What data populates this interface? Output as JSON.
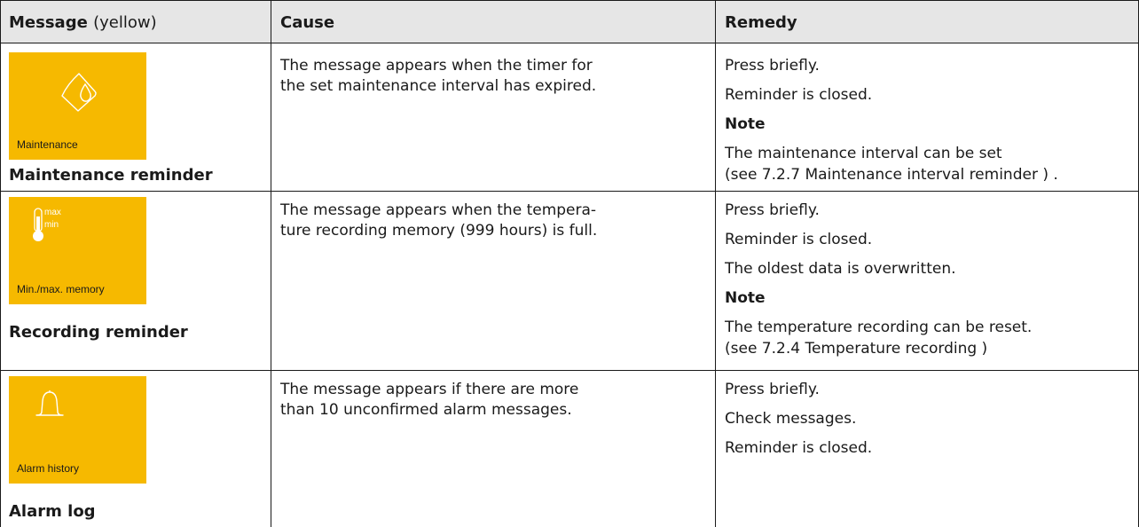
{
  "header": {
    "message": "Message",
    "message_note": "(yellow)",
    "cause": "Cause",
    "remedy": "Remedy"
  },
  "rows": [
    {
      "icon": "maintenance-drop-icon",
      "caption": "Maintenance",
      "name": "Maintenance reminder",
      "cause": [
        "The message appears when the timer for",
        "the set maintenance interval has expired."
      ],
      "remedy": [
        "Press briefly.",
        "Reminder is closed."
      ],
      "note_label": "Note",
      "note": [
        "The maintenance interval can be set",
        "(see 7.2.7 Maintenance interval reminder ) ."
      ]
    },
    {
      "icon": "thermometer-icon",
      "icon_labels": {
        "max": "max",
        "min": "min"
      },
      "caption": "Min./max. memory",
      "name": "Recording reminder",
      "cause": [
        "The message appears when the tempera-",
        "ture recording memory (999 hours) is full."
      ],
      "remedy": [
        "Press briefly.",
        "Reminder is closed.",
        "The oldest data is overwritten."
      ],
      "note_label": "Note",
      "note": [
        "The temperature recording can be reset.",
        "(see 7.2.4 Temperature recording )"
      ]
    },
    {
      "icon": "bell-icon",
      "caption": "Alarm history",
      "name": "Alarm log",
      "cause": [
        "The message appears if there are more",
        "than 10 unconfirmed alarm messages."
      ],
      "remedy": [
        "Press briefly.",
        "Check messages.",
        "Reminder is closed."
      ]
    }
  ],
  "colors": {
    "tile": "#f6b900",
    "header_bg": "#e6e6e6",
    "rule": "#1a1a1a"
  }
}
